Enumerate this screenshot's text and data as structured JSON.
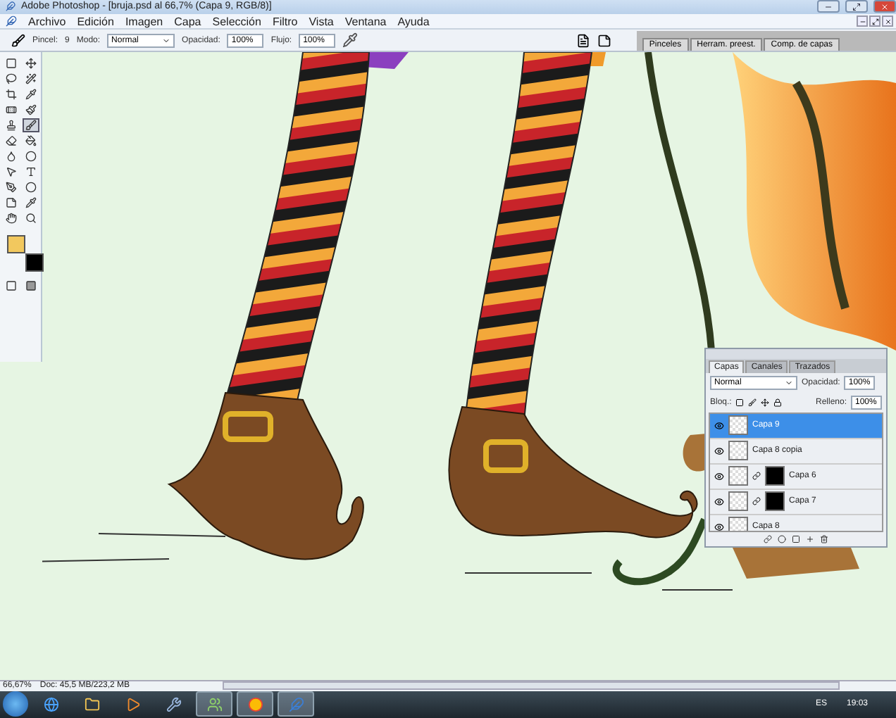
{
  "window": {
    "title": "Adobe Photoshop - [bruja.psd al 66,7% (Capa 9, RGB/8)]"
  },
  "menu": [
    "Archivo",
    "Edición",
    "Imagen",
    "Capa",
    "Selección",
    "Filtro",
    "Vista",
    "Ventana",
    "Ayuda"
  ],
  "options_bar": {
    "brush_label": "Pincel:",
    "brush_size": "9",
    "mode_label": "Modo:",
    "mode": "Normal",
    "opacity_label": "Opacidad:",
    "opacity": "100%",
    "flow_label": "Flujo:",
    "flow": "100%"
  },
  "palette_well": [
    {
      "label": "Pinceles"
    },
    {
      "label": "Herram. preest."
    },
    {
      "label": "Comp. de capas"
    }
  ],
  "toolbox": {
    "swatches": [
      {
        "kind": "foreground",
        "color": "#f2c85e"
      },
      {
        "kind": "background",
        "color": "#000000"
      }
    ]
  },
  "layers_panel": {
    "tabs": [
      {
        "label": "Capas",
        "selected": true
      },
      {
        "label": "Canales",
        "selected": false
      },
      {
        "label": "Trazados",
        "selected": false
      }
    ],
    "blend_mode": "Normal",
    "opacity_label": "Opacidad:",
    "opacity": "100%",
    "lock_label": "Bloq.:",
    "fill_label": "Relleno:",
    "fill": "100%",
    "layers": [
      {
        "name": "Capa 9",
        "selected": true,
        "visible": true,
        "mask": false
      },
      {
        "name": "Capa 8 copia",
        "selected": false,
        "visible": true,
        "mask": false
      },
      {
        "name": "Capa 6",
        "selected": false,
        "visible": true,
        "mask": true
      },
      {
        "name": "Capa 7",
        "selected": false,
        "visible": true,
        "mask": true
      },
      {
        "name": "Capa 8",
        "selected": false,
        "visible": true,
        "mask": false
      }
    ]
  },
  "status_bar": {
    "zoom": "66,67%",
    "doc": "Doc: 45,5 MB/223,2 MB"
  },
  "taskbar": {
    "apps": [
      {
        "kind": "browser-e",
        "active": false
      },
      {
        "kind": "folder",
        "active": false
      },
      {
        "kind": "media",
        "active": false
      },
      {
        "kind": "tool",
        "active": false
      },
      {
        "kind": "people",
        "active": true
      },
      {
        "kind": "chrome",
        "active": true
      },
      {
        "kind": "feather",
        "active": true
      }
    ],
    "language": "ES",
    "time": "19:03"
  }
}
